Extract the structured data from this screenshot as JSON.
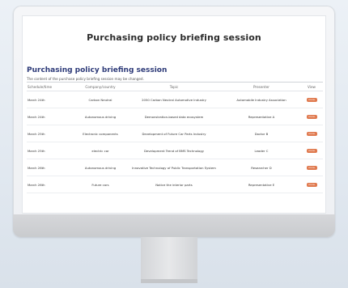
{
  "page": {
    "hero_title": "Purchasing policy briefing session",
    "section_title": "Purchasing policy briefing session",
    "section_subtitle": "The content of the purchase policy briefing session may be changed."
  },
  "table": {
    "headers": [
      "Schedule/time",
      "Company/country",
      "Topic",
      "Presenter",
      "View"
    ],
    "rows": [
      {
        "time": "March 24th",
        "company": "Carbon Neutral",
        "topic": "2050 Carbon Neutral Automotive Industry",
        "presenter": "Automobile Industry Association",
        "view": "more"
      },
      {
        "time": "March 24th",
        "company": "Autonomous driving",
        "topic": "Demonstration-based data ecosystem",
        "presenter": "Representative A",
        "view": "more"
      },
      {
        "time": "March 25th",
        "company": "Electronic components",
        "topic": "Development of Future Car Parts Industry",
        "presenter": "Doctor B",
        "view": "more"
      },
      {
        "time": "March 25th",
        "company": "electric car",
        "topic": "Development Trend of BMS Technology",
        "presenter": "Leader C",
        "view": "more"
      },
      {
        "time": "March 26th",
        "company": "Autonomous driving",
        "topic": "Innovative Technology of Public Transportation System",
        "presenter": "Researcher D",
        "view": "more"
      },
      {
        "time": "March 26th",
        "company": "Future cars",
        "topic": "Notice the interior parts",
        "presenter": "Representative E",
        "view": "more"
      }
    ]
  },
  "colors": {
    "title_navy": "#2d3a78",
    "view_button": "#e07a4f"
  }
}
